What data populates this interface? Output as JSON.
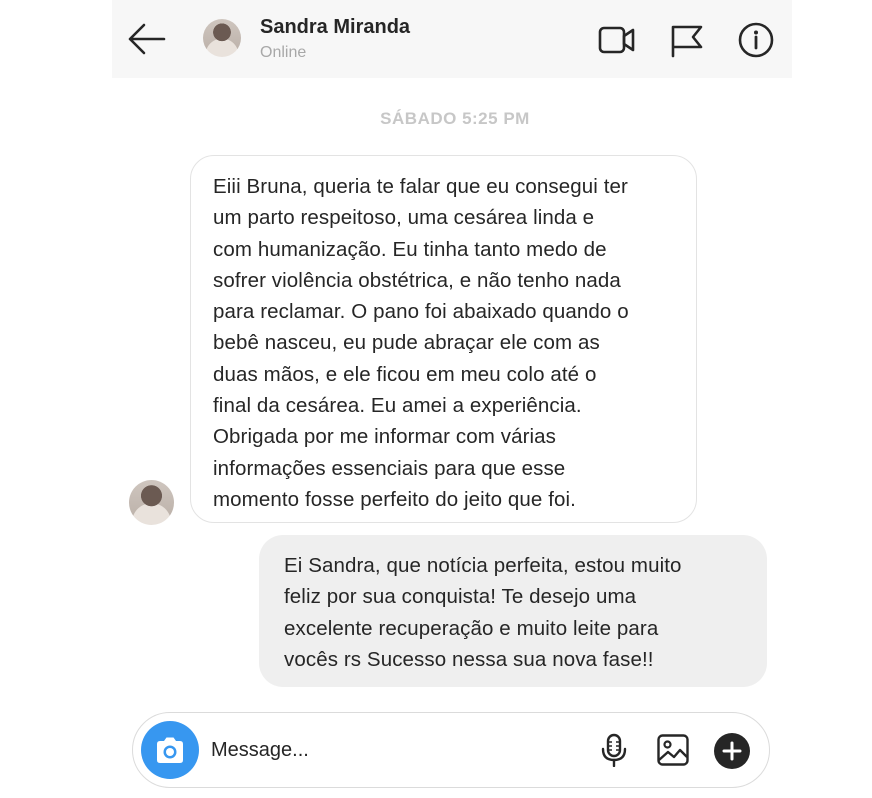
{
  "header": {
    "contact_name": "Sandra Miranda",
    "status": "Online",
    "icons": [
      "back-arrow-icon",
      "video-call-icon",
      "flag-icon",
      "info-icon"
    ]
  },
  "conversation": {
    "timestamp": "SÁBADO  5:25 PM",
    "messages": [
      {
        "direction": "incoming",
        "text": " Eiii Bruna, queria te falar que eu consegui ter\num parto respeitoso, uma cesárea linda e\ncom humanização. Eu tinha tanto medo de\nsofrer violência obstétrica, e não tenho nada\npara reclamar. O pano foi abaixado quando o\nbebê nasceu, eu pude abraçar ele com as\nduas mãos, e ele ficou em meu colo até o\nfinal da cesárea. Eu amei a experiência.\nObrigada por me informar com várias\ninformações essenciais para que esse\nmomento fosse perfeito do jeito que foi."
      },
      {
        "direction": "outgoing",
        "text": " Ei Sandra, que notícia perfeita, estou muito\nfeliz por sua conquista! Te desejo uma\nexcelente recuperação e muito leite para\nvocês rs Sucesso nessa sua nova fase!!"
      }
    ]
  },
  "composer": {
    "placeholder": "Message...",
    "icons": [
      "camera-icon",
      "microphone-icon",
      "gallery-icon",
      "plus-icon"
    ],
    "accent_color": "#3797f0"
  }
}
